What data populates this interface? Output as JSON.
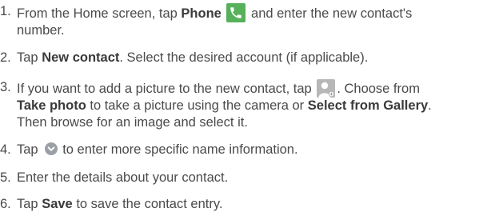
{
  "steps": [
    {
      "number": "1.",
      "line1_pre": "From the Home screen, tap ",
      "line1_bold": "Phone",
      "line1_icon": "phone-icon",
      "line1_post": " and enter the new contact's",
      "line2": "number."
    },
    {
      "number": "2.",
      "pre": "Tap ",
      "bold": "New contact",
      "post": ". Select the desired account (if applicable)."
    },
    {
      "number": "3.",
      "line1_pre": "If you want to add a picture to the new contact, tap ",
      "line1_icon": "add-contact-photo-icon",
      "line1_post": ". Choose from",
      "line2_bold1": "Take photo",
      "line2_mid": " to take a picture using the camera or ",
      "line2_bold2": "Select from Gallery",
      "line2_post": ".",
      "line3": "Then browse for an image and select it."
    },
    {
      "number": "4.",
      "pre": "Tap ",
      "icon": "chevron-down-icon",
      "post": "to enter more specific name information."
    },
    {
      "number": "5.",
      "text": "Enter the details about your contact."
    },
    {
      "number": "6.",
      "pre": "Tap ",
      "bold": "Save",
      "post": " to save the contact entry."
    }
  ],
  "colors": {
    "text": "#4a4a4a",
    "phone_icon_bg": "#56b15b",
    "contact_icon_bg": "#b7b7b7",
    "chevron_icon_bg": "#9aa0a6"
  }
}
